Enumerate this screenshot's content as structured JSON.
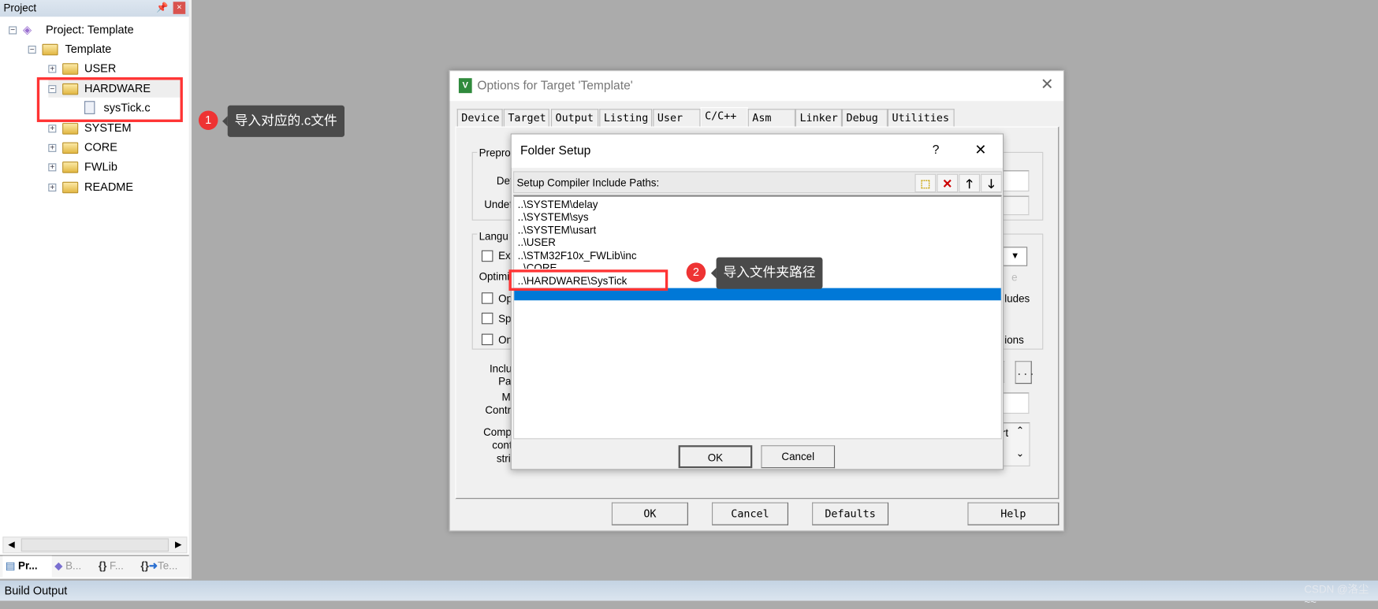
{
  "project_panel": {
    "title": "Project",
    "pin_icon": "pin-icon",
    "close_icon": "close-icon",
    "tree": [
      {
        "label": "Project: Template"
      },
      {
        "label": "Template"
      },
      {
        "label": "USER"
      },
      {
        "label": "HARDWARE"
      },
      {
        "label": "sysTick.c"
      },
      {
        "label": "SYSTEM"
      },
      {
        "label": "CORE"
      },
      {
        "label": "FWLib"
      },
      {
        "label": "README"
      }
    ],
    "tabs": [
      {
        "label": "Pr..."
      },
      {
        "label": "B..."
      },
      {
        "label": "F..."
      },
      {
        "label": "Te..."
      }
    ]
  },
  "build_output": {
    "title": "Build Output"
  },
  "callouts": [
    {
      "number": "1",
      "text": "导入对应的.c文件"
    },
    {
      "number": "2",
      "text": "导入文件夹路径"
    }
  ],
  "options_dialog": {
    "title": "Options for Target 'Template'",
    "tabs": [
      {
        "label": "Device"
      },
      {
        "label": "Target"
      },
      {
        "label": "Output"
      },
      {
        "label": "Listing"
      },
      {
        "label": "User"
      },
      {
        "label": "C/C++",
        "selected": true
      },
      {
        "label": "Asm"
      },
      {
        "label": "Linker"
      },
      {
        "label": "Debug"
      },
      {
        "label": "Utilities"
      }
    ],
    "partial_labels": {
      "prepro": "Prepro",
      "def": "Def",
      "undef": "Undef",
      "langu": "Langu",
      "ex": "Ex",
      "optimiz": "Optimiz",
      "op": "Op",
      "sp": "Sp",
      "on": "On",
      "ludes": "ludes",
      "ions": "ions",
      "e": "e",
      "inclu": "Inclu",
      "pat": "Pat",
      "m": "M",
      "contr": "Contr",
      "comp": "Comp",
      "cont": "cont",
      "stri": "stri",
      "rt": "rt",
      "ellipsis": "..."
    },
    "buttons": {
      "ok": "OK",
      "cancel": "Cancel",
      "defaults": "Defaults",
      "help": "Help"
    }
  },
  "folder_setup": {
    "title": "Folder Setup",
    "help": "?",
    "close": "X",
    "toolbar_label": "Setup Compiler Include Paths:",
    "toolbar_icons": [
      "new-folder-icon",
      "delete-icon",
      "move-up-icon",
      "move-down-icon"
    ],
    "paths": [
      "..\\SYSTEM\\delay",
      "..\\SYSTEM\\sys",
      "..\\SYSTEM\\usart",
      "..\\USER",
      "..\\STM32F10x_FWLib\\inc",
      "..\\CORE",
      "..\\HARDWARE\\SysTick"
    ],
    "selection_color": "#0078d7",
    "buttons": {
      "ok": "OK",
      "cancel": "Cancel"
    }
  },
  "watermark": "CSDN @洛尘~~"
}
